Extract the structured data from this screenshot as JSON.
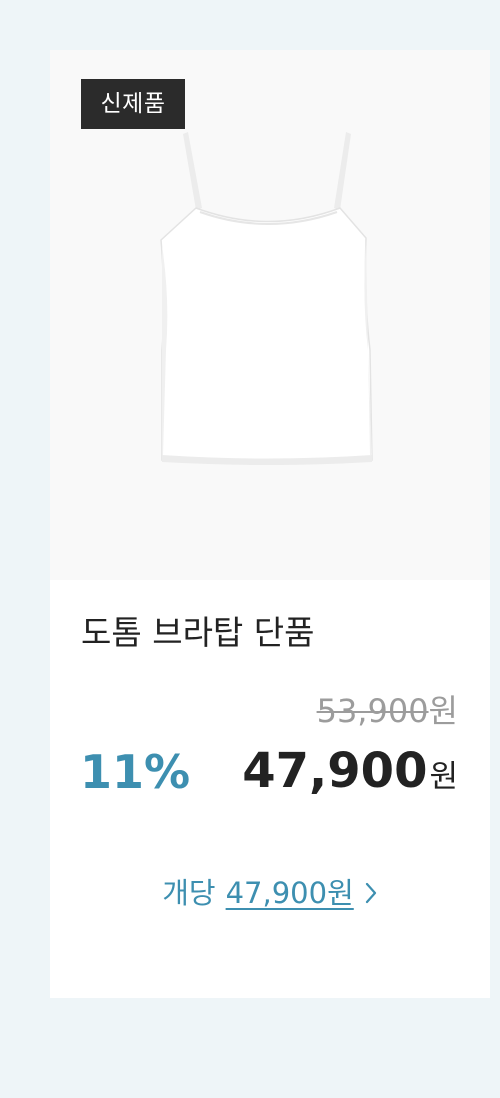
{
  "product": {
    "badge": "신제품",
    "title": "도톰 브라탑 단품",
    "original_price": "53,900",
    "original_currency": "원",
    "discount": "11%",
    "sale_price": "47,900",
    "sale_currency": "원",
    "unit_label": "개당",
    "unit_price": "47,900원",
    "image_icon": "camisole-product-image"
  },
  "colors": {
    "accent": "#3d8fb0",
    "badge_bg": "#2b2b2b",
    "page_bg": "#eef5f8"
  }
}
